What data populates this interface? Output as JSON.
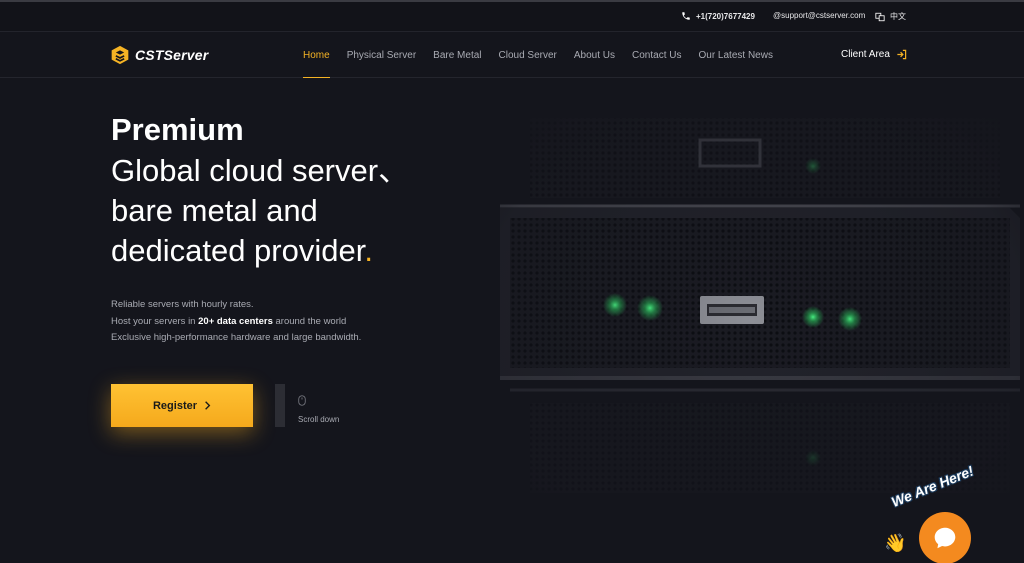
{
  "topbar": {
    "phone": "+1(720)7677429",
    "email": "@support@cstserver.com",
    "language": "中文"
  },
  "brand": {
    "name": "CSTServer",
    "accent_color": "#f5b324"
  },
  "nav": {
    "items": [
      {
        "label": "Home",
        "active": true
      },
      {
        "label": "Physical Server"
      },
      {
        "label": "Bare Metal"
      },
      {
        "label": "Cloud Server"
      },
      {
        "label": "About Us"
      },
      {
        "label": "Contact Us"
      },
      {
        "label": "Our Latest News"
      }
    ],
    "client_area": "Client Area"
  },
  "hero": {
    "title": "Premium",
    "line1": "Global cloud server、",
    "line2": "bare metal and",
    "line3": "dedicated provider",
    "line3_dot": ".",
    "desc1": "Reliable servers with hourly rates.",
    "desc2_pre": "Host your servers in ",
    "desc2_bold": "20+ data centers",
    "desc2_post": " around the world",
    "desc3": "Exclusive high-performance hardware and large bandwidth.",
    "register": "Register",
    "scroll": "Scroll down"
  },
  "chat": {
    "badge": "We Are Here!",
    "wave_emoji": "👋"
  }
}
